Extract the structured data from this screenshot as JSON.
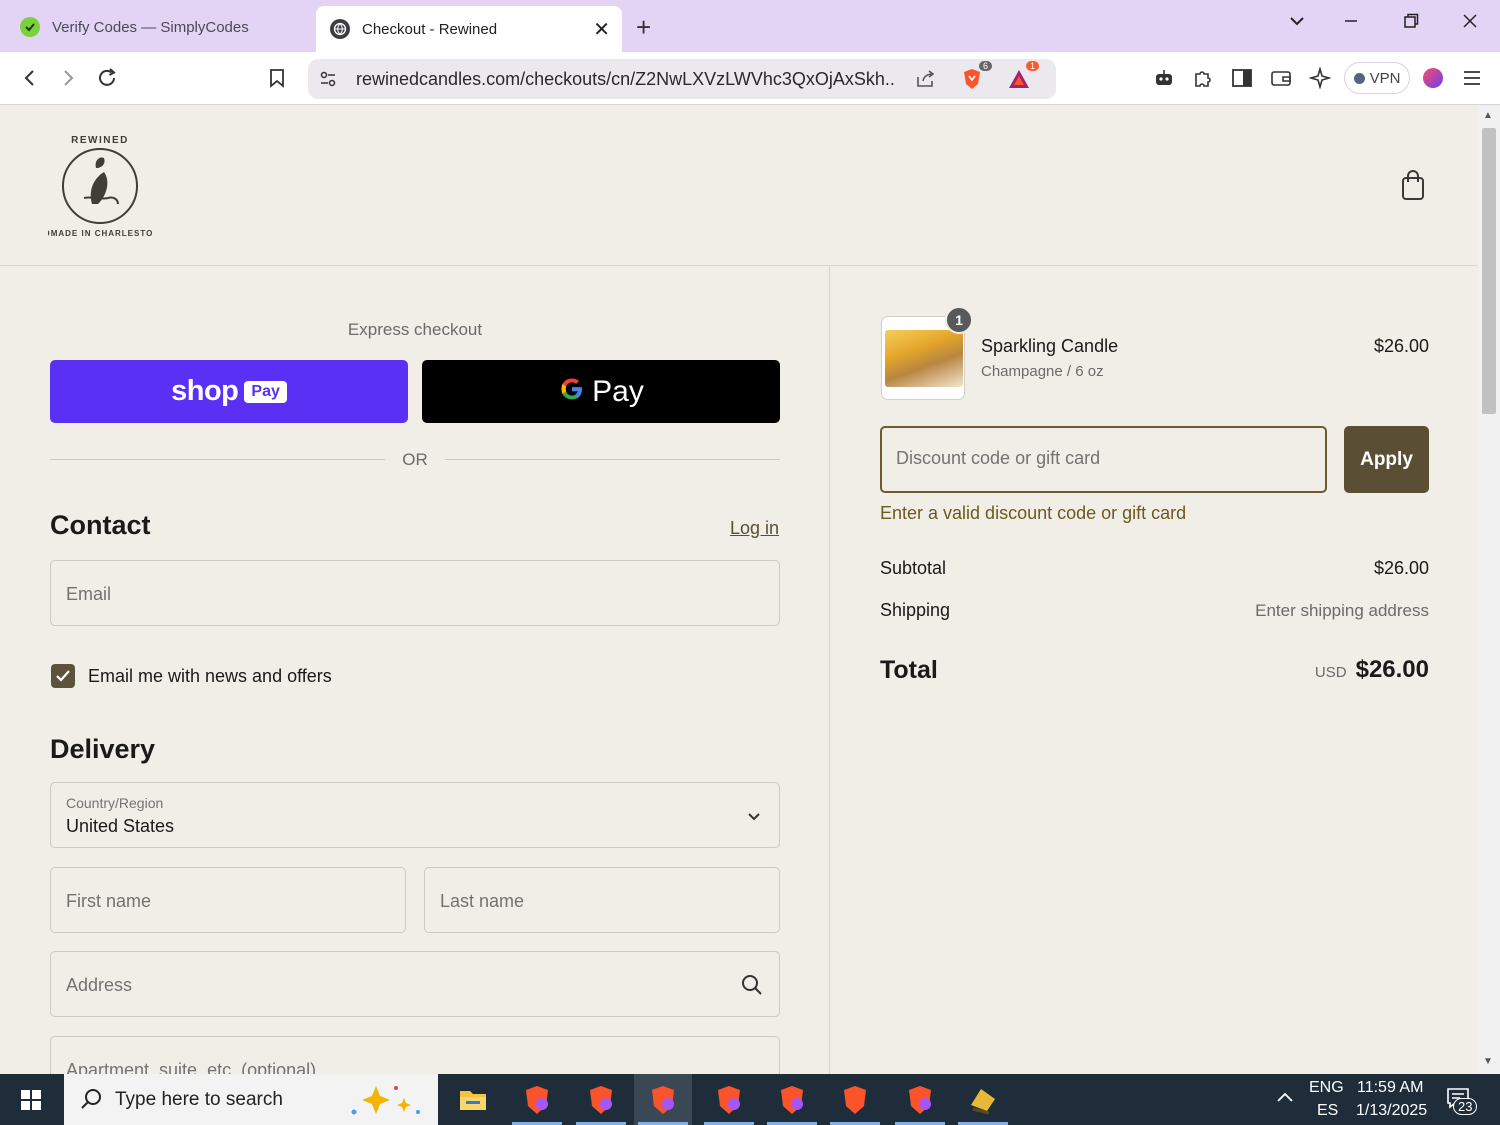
{
  "browser": {
    "tabs": [
      {
        "title": "Verify Codes — SimplyCodes",
        "active": false
      },
      {
        "title": "Checkout - Rewined",
        "active": true
      }
    ],
    "new_tab": "+",
    "url": "rewinedcandles.com/checkouts/cn/Z2NwLXVzLWVhc3QxOjAxSkh...",
    "shield_count": "6",
    "alert_count": "1",
    "vpn_label": "VPN"
  },
  "checkout": {
    "express_label": "Express checkout",
    "shop_pay": {
      "word": "shop",
      "chip": "Pay"
    },
    "gpay_label": "Pay",
    "or_label": "OR",
    "contact": {
      "title": "Contact",
      "login_link": "Log in",
      "email_placeholder": "Email",
      "newsletter_label": "Email me with news and offers",
      "newsletter_checked": true
    },
    "delivery": {
      "title": "Delivery",
      "country_label": "Country/Region",
      "country_value": "United States",
      "first_name_placeholder": "First name",
      "last_name_placeholder": "Last name",
      "address_placeholder": "Address",
      "apartment_placeholder": "Apartment, suite, etc. (optional)"
    }
  },
  "order": {
    "item": {
      "name": "Sparkling Candle",
      "variant": "Champagne / 6 oz",
      "price": "$26.00",
      "quantity": "1"
    },
    "discount_placeholder": "Discount code or gift card",
    "apply_label": "Apply",
    "discount_error": "Enter a valid discount code or gift card",
    "subtotal_label": "Subtotal",
    "subtotal_value": "$26.00",
    "shipping_label": "Shipping",
    "shipping_value": "Enter shipping address",
    "total_label": "Total",
    "total_currency": "USD",
    "total_value": "$26.00"
  },
  "taskbar": {
    "search_placeholder": "Type here to search",
    "lang_top": "ENG",
    "lang_bottom": "ES",
    "time": "11:59 AM",
    "date": "1/13/2025",
    "notification_count": "23"
  },
  "colors": {
    "page_bg": "#f1ede7",
    "accent": "#5a4f35",
    "shop_pay": "#5a31f4",
    "tabstrip": "#e3d4f5"
  }
}
